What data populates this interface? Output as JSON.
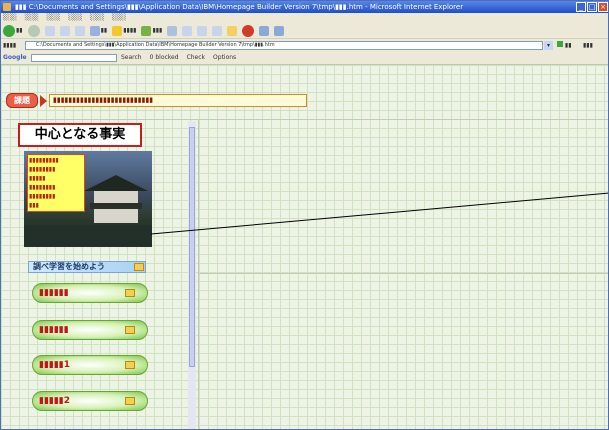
{
  "window": {
    "title": "▮▮▮ C:\\Documents and Settings\\▮▮▮\\Application Data\\IBM\\Homepage Builder Version 7\\tmp\\▮▮▮.htm - Microsoft Internet Explorer"
  },
  "menubar": {
    "items": [
      "░░░",
      "░░░",
      "░░░",
      "░░░",
      "░░░",
      "░░░"
    ]
  },
  "toolbar": {
    "back_icon": "back-arrow-icon",
    "forward_icon": "forward-arrow-icon",
    "search_label": "▮▮",
    "favorites_label": "▮▮▮▮",
    "media_label": "▮▮▮"
  },
  "address": {
    "label": "▮▮▮▮",
    "value": "C:\\Documents and Settings\\▮▮▮\\Application Data\\IBM\\Homepage Builder Version 7\\tmp\\▮▮▮.htm",
    "go_label": "▮▮",
    "links_label": "▮▮▮"
  },
  "googlebar": {
    "brand": "Google",
    "search_label": "Search",
    "blocked_label": "0 blocked",
    "check_label": "Check",
    "options_label": "Options"
  },
  "task": {
    "badge": "課題",
    "text": "▮▮▮▮▮▮▮▮▮▮▮▮▮▮▮▮▮▮▮▮▮▮▮▮▮▮"
  },
  "sidebar": {
    "heading": "中心となる事実",
    "photo_caption": "▮▮▮▮▮▮▮▮▮\n▮▮▮▮▮▮▮▮\n▮▮▮▮▮\n▮▮▮▮▮▮▮▮\n▮▮▮▮▮▮▮▮\n▮▮▮",
    "section_label": "調べ学習を始めよう",
    "topics": [
      "▮▮▮▮▮▮",
      "▮▮▮▮▮▮",
      "▮▮▮▮▮1",
      "▮▮▮▮▮2"
    ]
  },
  "colors": {
    "grid_background": "#edf4e6",
    "task_badge": "#e8604a",
    "heading_border": "#c02020",
    "topic_button": "#7fc64a",
    "titlebar": "#1d4fc8"
  }
}
